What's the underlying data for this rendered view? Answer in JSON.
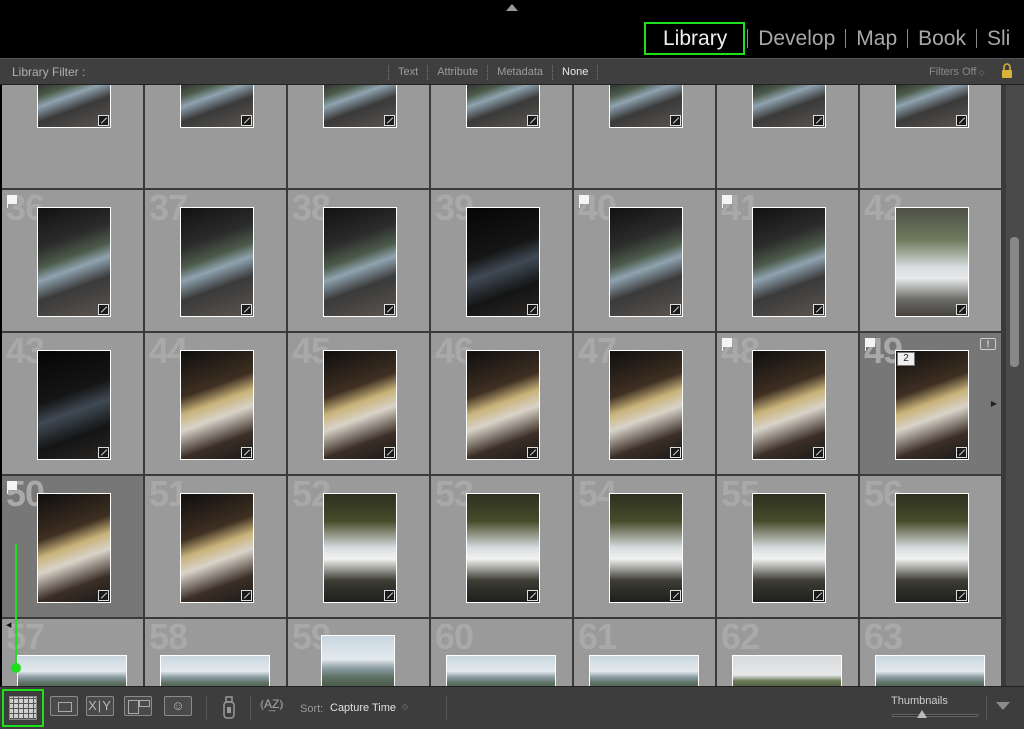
{
  "colors": {
    "highlight": "#1fdd1f",
    "cell_bg": "#9a9a9a",
    "selected_cell_bg": "#777777"
  },
  "module_picker": {
    "modules": [
      {
        "label": "Library",
        "active": true
      },
      {
        "label": "Develop",
        "active": false
      },
      {
        "label": "Map",
        "active": false
      },
      {
        "label": "Book",
        "active": false
      },
      {
        "label": "Sli",
        "active": false
      }
    ]
  },
  "filter_bar": {
    "title": "Library Filter :",
    "options": [
      {
        "label": "Text",
        "active": false
      },
      {
        "label": "Attribute",
        "active": false
      },
      {
        "label": "Metadata",
        "active": false
      },
      {
        "label": "None",
        "active": true
      }
    ],
    "filters_off_label": "Filters Off",
    "lock_icon": "lock-icon"
  },
  "grid": {
    "rows": [
      {
        "cells": [
          {
            "number": "",
            "style": "cave",
            "flag": false
          },
          {
            "number": "",
            "style": "cave",
            "flag": false
          },
          {
            "number": "",
            "style": "cave",
            "flag": false
          },
          {
            "number": "",
            "style": "cave",
            "flag": false
          },
          {
            "number": "",
            "style": "cave",
            "flag": false
          },
          {
            "number": "",
            "style": "cave",
            "flag": false
          },
          {
            "number": "",
            "style": "cave",
            "flag": false
          }
        ]
      },
      {
        "cells": [
          {
            "number": "36",
            "style": "cave",
            "flag": true
          },
          {
            "number": "37",
            "style": "cave",
            "flag": false
          },
          {
            "number": "38",
            "style": "cave",
            "flag": false
          },
          {
            "number": "39",
            "style": "dark",
            "flag": false
          },
          {
            "number": "40",
            "style": "cave",
            "flag": true
          },
          {
            "number": "41",
            "style": "cave",
            "flag": true
          },
          {
            "number": "42",
            "style": "fall",
            "flag": false,
            "landscape_tall": true
          }
        ]
      },
      {
        "cells": [
          {
            "number": "43",
            "style": "dark",
            "flag": false
          },
          {
            "number": "44",
            "style": "warm",
            "flag": false
          },
          {
            "number": "45",
            "style": "warm",
            "flag": false
          },
          {
            "number": "46",
            "style": "warm",
            "flag": false
          },
          {
            "number": "47",
            "style": "warm",
            "flag": false
          },
          {
            "number": "48",
            "style": "warm",
            "flag": true
          },
          {
            "number": "49",
            "style": "warm",
            "flag": true,
            "selected": true,
            "stack_count": "2",
            "warning": "!"
          }
        ]
      },
      {
        "cells": [
          {
            "number": "50",
            "style": "warm",
            "flag": true,
            "selected": true
          },
          {
            "number": "51",
            "style": "warm",
            "flag": false
          },
          {
            "number": "52",
            "style": "canyon",
            "flag": false
          },
          {
            "number": "53",
            "style": "canyon",
            "flag": false
          },
          {
            "number": "54",
            "style": "canyon",
            "flag": false
          },
          {
            "number": "55",
            "style": "canyon",
            "flag": false
          },
          {
            "number": "56",
            "style": "canyon",
            "flag": false
          }
        ]
      },
      {
        "cells": [
          {
            "number": "57",
            "style": "land",
            "flag": false,
            "wide": true
          },
          {
            "number": "58",
            "style": "land",
            "flag": false,
            "wide": true
          },
          {
            "number": "59",
            "style": "land",
            "flag": false,
            "square": true
          },
          {
            "number": "60",
            "style": "land",
            "flag": false,
            "wide": true
          },
          {
            "number": "61",
            "style": "land",
            "flag": false,
            "wide": true
          },
          {
            "number": "62",
            "style": "trees",
            "flag": false,
            "wide": true
          },
          {
            "number": "63",
            "style": "land",
            "flag": false,
            "wide": true
          }
        ]
      }
    ]
  },
  "toolbar": {
    "compare_label": "X|Y",
    "sort_label": "Sort:",
    "sort_value": "Capture Time",
    "thumbnails_label": "Thumbnails",
    "thumbnail_size": 0.34
  }
}
